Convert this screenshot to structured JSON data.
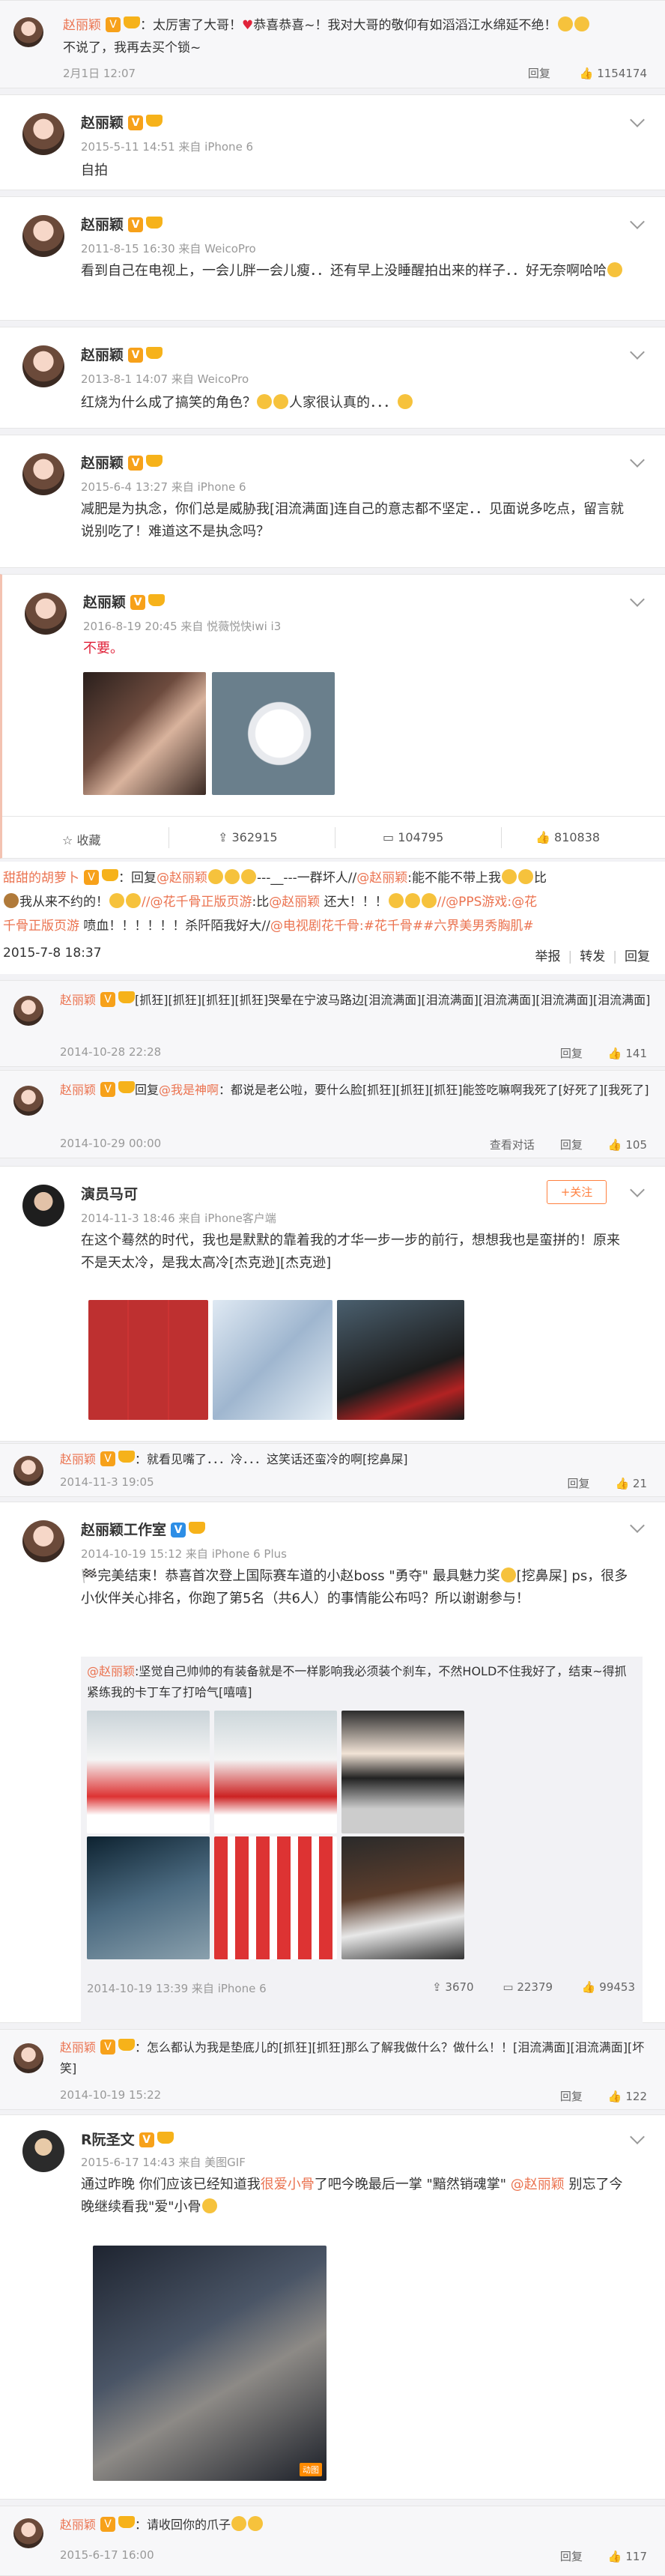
{
  "posts": [
    {
      "reply_text": "：太厉害了大哥！",
      "reply_text2": "恭喜恭喜~！我对大哥的敬仰有如滔滔江水绵延不绝！",
      "reply_line2": "不说了，我再去买个锁~",
      "author": "赵丽颖",
      "date": "2月1日 12:07",
      "reply_label": "回复",
      "likes": "1154174"
    },
    {
      "author": "赵丽颖",
      "meta": "2015-5-11 14:51 来自 iPhone 6",
      "text": "自拍"
    },
    {
      "author": "赵丽颖",
      "meta": "2011-8-15 16:30 来自 WeicoPro",
      "text": "看到自己在电视上，一会儿胖一会儿瘦．．还有早上没睡醒拍出来的样子．．好无奈啊哈哈"
    },
    {
      "author": "赵丽颖",
      "meta": "2013-8-1 14:07 来自 WeicoPro",
      "text": "红烧为什么成了搞笑的角色？",
      "text_tail": "人家很认真的．．．"
    },
    {
      "author": "赵丽颖",
      "meta": "2015-6-4 13:27 来自 iPhone 6",
      "text": "减肥是为执念，你们总是威胁我[泪流满面]连自己的意志都不坚定．．见面说多吃点，留言就说别吃了！难道这不是执念吗？"
    },
    {
      "author": "赵丽颖",
      "meta": "2016-8-19 20:45 来自 悦薇悦快iwi i3",
      "text": "不要。",
      "bar": {
        "collect": "收藏",
        "repost": "362915",
        "comment": "104795",
        "like": "810838"
      }
    }
  ],
  "repost_chain": {
    "line1_a": "甜甜的胡萝卜",
    "line1_b": "：回复",
    "line1_c": "@赵丽颖",
    "line1_d": "---__---一群坏人//",
    "line1_e": "@赵丽颖",
    "line1_f": ":能不能不带上我",
    "line1_g": "比",
    "line2_a": "我从来不约的！",
    "line2_b": "//@花千骨正版页游",
    "line2_c": ":比",
    "line2_d": "@赵丽颖",
    "line2_e": " 还大！！！",
    "line2_f": "//@PPS游戏",
    "line2_g": ":@花",
    "line3_a": "千骨正版页游",
    "line3_b": " 喷血！！！！！！杀阡陌我好大//",
    "line3_c": "@电视剧花千骨",
    "line3_d": ":#花千骨##六界美男秀胸肌#",
    "date": "2015-7-8 18:37",
    "action_like": "举报",
    "action_repost": "转发",
    "action_more": "回复"
  },
  "comments": [
    {
      "author": "赵丽颖",
      "text": "[抓狂][抓狂][抓狂][抓狂]哭晕在宁波马路边[泪流满面][泪流满面][泪流满面][泪流满面][泪流满面]",
      "date": "2014-10-28 22:28",
      "reply": "回复",
      "likes": "141"
    },
    {
      "author": "赵丽颖",
      "text_a": "回复",
      "text_b": "@我是神啊",
      "text_c": "：都说是老公啦，要什么脸[抓狂][抓狂][抓狂]能签吃嘛啊我死了[好死了][我死了]",
      "date": "2014-10-29 00:00",
      "extra": "查看对话",
      "reply": "回复",
      "likes": "105"
    }
  ],
  "post_yuanfu": {
    "author": "演员马可",
    "follow": "+关注",
    "meta": "2014-11-3 18:46 来自 iPhone客户端",
    "text": "在这个蓦然的时代，我也是默默的靠着我的才华一步一步的前行，想想我也是蛮拼的！原来不是天太冷，是我太高冷[杰克逊][杰克逊]"
  },
  "comment_3": {
    "author": "赵丽颖",
    "text": "：就看见嘴了．．．冷．．．这笑话还蛮冷的啊[挖鼻屎]",
    "date": "2014-11-3 19:05",
    "reply": "回复",
    "likes": "21"
  },
  "post_studio": {
    "author": "赵丽颖工作室",
    "meta": "2014-10-19 15:12 来自 iPhone 6 Plus",
    "text_a": "完美结束！恭喜首次登上国际赛车道的小赵boss \"勇夺\" 最具魅力奖",
    "text_b": "[挖鼻屎] ps，很多小伙伴关心排名，你跑了第5名（共6人）的事情能公布吗？所以谢谢参与！",
    "quote_user": "@赵丽颖",
    "quote_text": ":坚觉自己帅帅的有装备就是不一样影响我必须装个刹车，不然HOLD不住我好了，结束~得抓紧练我的卡丁车了打哈气[嘻嘻]",
    "quote_meta": "2014-10-19 13:39 来自 iPhone 6",
    "bar": {
      "repost": "3670",
      "comment": "22379",
      "like": "99453"
    }
  },
  "comment_4": {
    "author": "赵丽颖",
    "text": "：怎么都认为我是垫底儿的[抓狂][抓狂]那么了解我做什么？做什么！！[泪流满面][泪流满面][坏笑]",
    "date": "2014-10-19 15:22",
    "reply": "回复",
    "likes": "122"
  },
  "post_ryan": {
    "author": "R阮圣文",
    "meta": "2015-6-17 14:43 来自 美图GIF",
    "text_a": "通过昨晚 你们应该已经知道我",
    "text_b": "很爱小骨",
    "text_c": "了吧今晚最后一掌 \"黯然销魂掌\" ",
    "text_d": "@赵丽颖",
    "text_e": " 别忘了今晚继续看我\"爱\"小骨",
    "gif_label": "动图"
  },
  "comment_5": {
    "author": "赵丽颖",
    "text": "：请收回你的爪子",
    "date": "2015-6-17 16:00",
    "reply": "回复",
    "likes": "117"
  },
  "colors": {
    "orange": "#eb7350",
    "link": "#eb7350",
    "badge": "#f7a11a",
    "bg": "#f2f2f5"
  }
}
